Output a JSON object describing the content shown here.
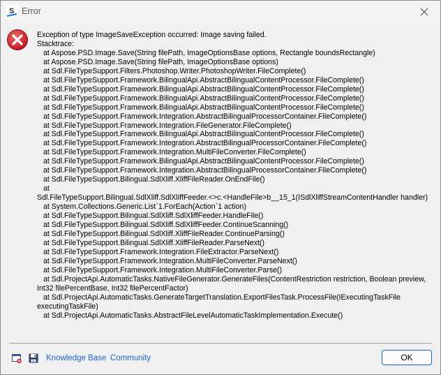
{
  "window": {
    "title": "Error",
    "close_label": "×"
  },
  "message": {
    "headline": "Exception of type ImageSaveException occurred: Image saving failed.",
    "stacktrace_label": "Stacktrace:",
    "lines": [
      "at Aspose.PSD.Image.Save(String filePath, ImageOptionsBase options, Rectangle boundsRectangle)",
      "at Aspose.PSD.Image.Save(String filePath, ImageOptionsBase options)",
      "at Sdl.FileTypeSupport.Filters.Photoshop.Writer.PhotoshopWriter.FileComplete()",
      "at Sdl.FileTypeSupport.Framework.BilingualApi.AbstractBilingualContentProcessor.FileComplete()",
      "at Sdl.FileTypeSupport.Framework.BilingualApi.AbstractBilingualContentProcessor.FileComplete()",
      "at Sdl.FileTypeSupport.Framework.BilingualApi.AbstractBilingualContentProcessor.FileComplete()",
      "at Sdl.FileTypeSupport.Framework.BilingualApi.AbstractBilingualContentProcessor.FileComplete()",
      "at Sdl.FileTypeSupport.Framework.Integration.AbstractBilingualProcessorContainer.FileComplete()",
      "at Sdl.FileTypeSupport.Framework.Integration.FileGenerator.FileComplete()",
      "at Sdl.FileTypeSupport.Framework.BilingualApi.AbstractBilingualContentProcessor.FileComplete()",
      "at Sdl.FileTypeSupport.Framework.Integration.AbstractBilingualProcessorContainer.FileComplete()",
      "at Sdl.FileTypeSupport.Framework.Integration.MultiFileConverter.FileComplete()",
      "at Sdl.FileTypeSupport.Framework.BilingualApi.AbstractBilingualContentProcessor.FileComplete()",
      "at Sdl.FileTypeSupport.Framework.Integration.AbstractBilingualProcessorContainer.FileComplete()",
      "at Sdl.FileTypeSupport.Bilingual.SdlXliff.XliffFileReader.OnEndFile()",
      "at",
      "Sdl.FileTypeSupport.Bilingual.SdlXliff.SdlXliffFeeder.<>c.<HandleFile>b__15_1(ISdlXliffStreamContentHandler handler)",
      "at System.Collections.Generic.List`1.ForEach(Action`1 action)",
      "at Sdl.FileTypeSupport.Bilingual.SdlXliff.SdlXliffFeeder.HandleFile()",
      "at Sdl.FileTypeSupport.Bilingual.SdlXliff.SdlXliffFeeder.ContinueScanning()",
      "at Sdl.FileTypeSupport.Bilingual.SdlXliff.XliffFileReader.ContinueParsing()",
      "at Sdl.FileTypeSupport.Bilingual.SdlXliff.XliffFileReader.ParseNext()",
      "at Sdl.FileTypeSupport.Framework.Integration.FileExtractor.ParseNext()",
      "at Sdl.FileTypeSupport.Framework.Integration.MultiFileConverter.ParseNext()",
      "at Sdl.FileTypeSupport.Framework.Integration.MultiFileConverter.Parse()",
      "at Sdl.ProjectApi.AutomaticTasks.NativeFileGenerator.GenerateFiles(ContentRestriction restriction, Boolean preview, Int32 filePercentBase, Int32 filePercentFactor)",
      "at Sdl.ProjectApi.AutomaticTasks.GenerateTargetTranslation.ExportFilesTask.ProcessFile(IExecutingTaskFile executingTaskFile)",
      "at Sdl.ProjectApi.AutomaticTasks.AbstractFileLevelAutomaticTaskImplementation.Execute()"
    ]
  },
  "footer": {
    "icons": [
      "document-error-icon",
      "save-icon"
    ],
    "links": {
      "knowledge_base": "Knowledge Base",
      "community": "Community"
    },
    "ok_label": "OK"
  },
  "colors": {
    "link": "#1a63c9",
    "error_red": "#c8202b",
    "ok_border": "#0a64c8"
  }
}
